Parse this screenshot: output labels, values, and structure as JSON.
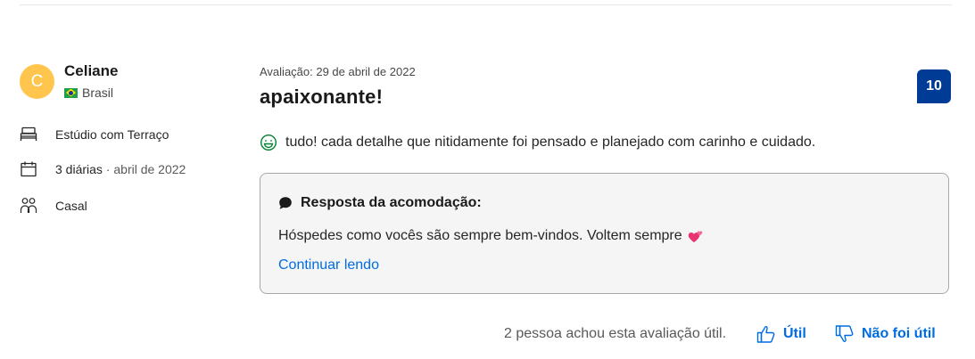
{
  "reviewer": {
    "avatar_initial": "C",
    "name": "Celiane",
    "country": "Brasil",
    "room_type": "Estúdio com Terraço",
    "stay_nights": "3 diárias",
    "stay_separator": " · ",
    "stay_month": "abril de 2022",
    "traveler_type": "Casal"
  },
  "review": {
    "date": "Avaliação: 29 de abril de 2022",
    "title": "apaixonante!",
    "score": "10",
    "positive_text": "tudo! cada detalhe que nitidamente foi pensado e planejado com carinho e cuidado."
  },
  "property_response": {
    "title": "Resposta da acomodação:",
    "text": "Hóspedes como vocês são sempre bem-vindos. Voltem sempre",
    "continue_label": "Continuar lendo"
  },
  "helpful": {
    "count_text": "2 pessoa achou esta avaliação útil.",
    "useful_label": "Útil",
    "not_useful_label": "Não foi útil"
  },
  "colors": {
    "avatar": "#ffc54d",
    "score_badge": "#003b95",
    "link": "#006ce4",
    "positive_icon": "#008234",
    "heart": "#e8336f"
  }
}
